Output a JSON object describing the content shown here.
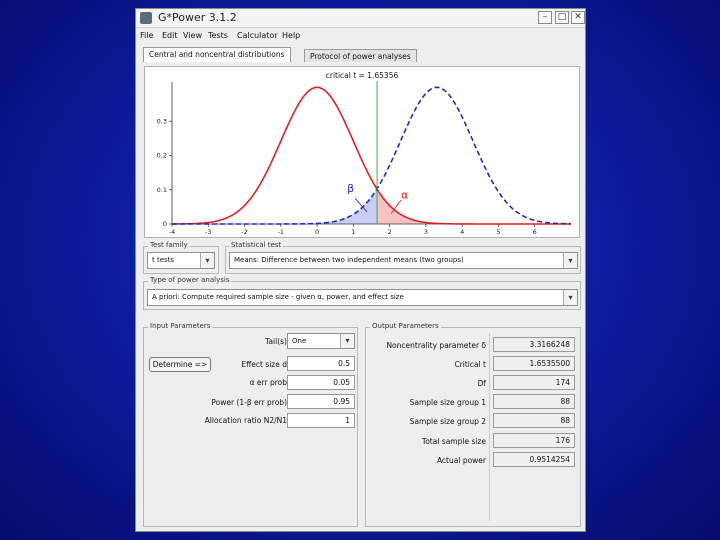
{
  "window": {
    "title": "G*Power 3.1.2"
  },
  "menu": [
    "File",
    "Edit",
    "View",
    "Tests",
    "Calculator",
    "Help"
  ],
  "tabs": [
    "Central and noncentral distributions",
    "Protocol of power analyses"
  ],
  "chart_data": {
    "type": "line",
    "title": "critical t = 1.65356",
    "critical_t": 1.65356,
    "xlim": [
      -4,
      7
    ],
    "ylim": [
      0,
      0.4
    ],
    "x_ticks": [
      "-4",
      "-3",
      "-2",
      "-1",
      "0",
      "1",
      "2",
      "3",
      "4",
      "5",
      "6"
    ],
    "y_ticks": [
      "0",
      "0.1",
      "0.2",
      "0.3"
    ],
    "series": [
      {
        "name": "",
        "style": "solid",
        "color": "#e02020",
        "center": 0
      },
      {
        "name": "",
        "style": "dashed",
        "color": "#1f2ab8",
        "center": 3.3
      }
    ],
    "annotations": [
      "β",
      "α"
    ]
  },
  "test_family": {
    "label": "Test family",
    "value": "t tests"
  },
  "statistical_test": {
    "label": "Statistical test",
    "value": "Means: Difference between two independent means (two groups)"
  },
  "power_analysis": {
    "label": "Type of power analysis",
    "value": "A priori: Compute required sample size - given α, power, and effect size"
  },
  "input": {
    "label": "Input Parameters",
    "determine_label": "Determine =>",
    "rows": [
      {
        "label": "Tail(s)",
        "value": "One"
      },
      {
        "label": "Effect size d",
        "value": "0.5"
      },
      {
        "label": "α err prob",
        "value": "0.05"
      },
      {
        "label": "Power (1-β err prob)",
        "value": "0.95"
      },
      {
        "label": "Allocation ratio N2/N1",
        "value": "1"
      }
    ]
  },
  "output": {
    "label": "Output Parameters",
    "rows": [
      {
        "label": "Noncentrality parameter δ",
        "value": "3.3166248"
      },
      {
        "label": "Critical t",
        "value": "1.6535500"
      },
      {
        "label": "Df",
        "value": "174"
      },
      {
        "label": "Sample size group 1",
        "value": "88"
      },
      {
        "label": "Sample size group 2",
        "value": "88"
      },
      {
        "label": "Total sample size",
        "value": "176"
      },
      {
        "label": "Actual power",
        "value": "0.9514254"
      }
    ]
  },
  "colors": {
    "null_curve": "#e02020",
    "alt_curve": "#1f2ab8",
    "critical_line": "#22b022"
  }
}
